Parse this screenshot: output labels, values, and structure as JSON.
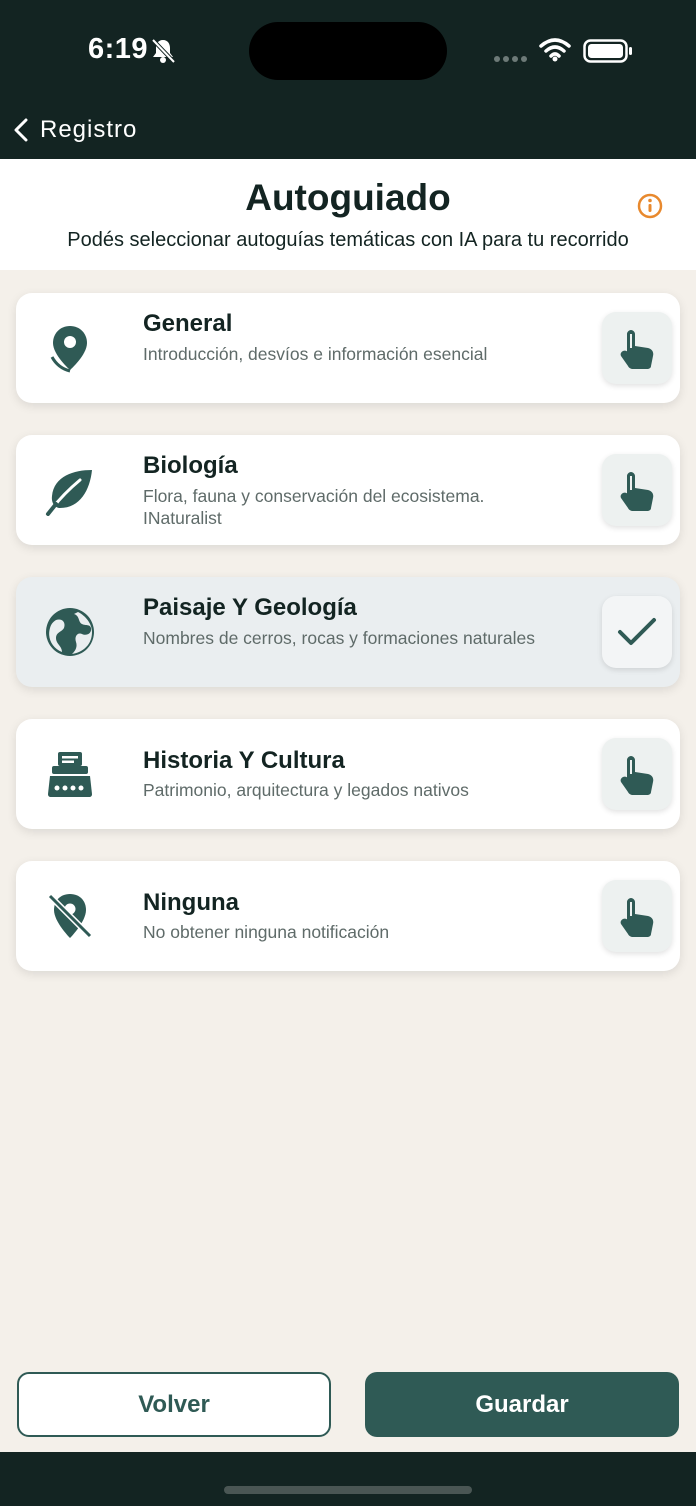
{
  "status_bar": {
    "time": "6:19",
    "icons": [
      "bell-slash-icon",
      "signal-icon",
      "wifi-icon",
      "battery-icon"
    ]
  },
  "nav": {
    "back_label": "Registro"
  },
  "header": {
    "title": "Autoguiado",
    "subtitle": "Podés seleccionar autoguías temáticas con IA para tu recorrido",
    "info_icon": "info-circle-icon"
  },
  "options": [
    {
      "title": "General",
      "description": "Introducción, desvíos e información esencial",
      "icon": "map-pin-icon",
      "selected": false
    },
    {
      "title": "Biología",
      "description": "Flora, fauna y conservación del ecosistema. INaturalist",
      "icon": "leaf-icon",
      "selected": false
    },
    {
      "title": "Paisaje Y Geología",
      "description": "Nombres de cerros, rocas y formaciones naturales",
      "icon": "globe-icon",
      "selected": true
    },
    {
      "title": "Historia Y Cultura",
      "description": "Patrimonio, arquitectura y legados nativos",
      "icon": "typewriter-icon",
      "selected": false
    },
    {
      "title": "Ninguna",
      "description": "No obtener ninguna notificación",
      "icon": "map-pin-off-icon",
      "selected": false
    }
  ],
  "buttons": {
    "back": "Volver",
    "save": "Guardar"
  },
  "colors": {
    "dark": "#132422",
    "primary": "#2f5a55",
    "background": "#f4f0ea",
    "info_accent": "#e8892e",
    "selected_card": "#eaeef0"
  }
}
